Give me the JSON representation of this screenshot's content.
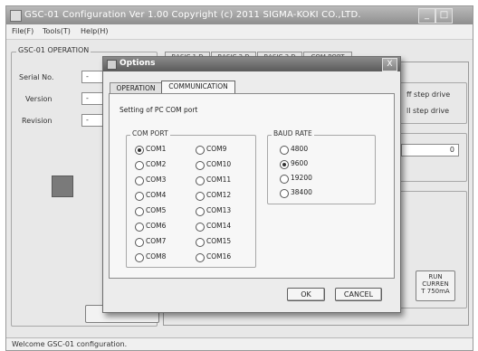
{
  "app": {
    "title": "GSC-01 Configuration   Ver 1.00   Copyright (c) 2011   SIGMA-KOKI CO.,LTD.",
    "window_buttons": [
      "_",
      "□"
    ]
  },
  "menu": [
    "File(F)",
    "Tools(T)",
    "Help(H)"
  ],
  "main": {
    "group_title": "GSC-01 OPERATION",
    "fields": [
      {
        "label": "Serial No.",
        "value": "-"
      },
      {
        "label": "Version",
        "value": "-"
      },
      {
        "label": "Revision",
        "value": "-"
      }
    ],
    "tabs": [
      "BASIC 1 D",
      "BASIC 2 D",
      "BASIC 3 D",
      "COM PORT"
    ],
    "right_options": [
      "ff step drive",
      "ll step drive"
    ],
    "speed_value": "0",
    "run_current_lines": [
      "RUN",
      "CURREN",
      "T 750mA"
    ]
  },
  "status_text": "Welcome GSC-01 configuration.",
  "dialog": {
    "title": "Options",
    "close_glyph": "X",
    "tabs": [
      "OPERATION",
      "COMMUNICATION"
    ],
    "active_tab": "COMMUNICATION",
    "heading": "Setting of PC COM port",
    "com_port": {
      "title": "COM PORT",
      "selected": "COM1",
      "col1": [
        "COM1",
        "COM2",
        "COM3",
        "COM4",
        "COM5",
        "COM6",
        "COM7",
        "COM8"
      ],
      "col2": [
        "COM9",
        "COM10",
        "COM11",
        "COM12",
        "COM13",
        "COM14",
        "COM15",
        "COM16"
      ]
    },
    "baud_rate": {
      "title": "BAUD RATE",
      "selected": "9600",
      "options": [
        "4800",
        "9600",
        "19200",
        "38400"
      ]
    },
    "ok_label": "OK",
    "cancel_label": "CANCEL"
  }
}
